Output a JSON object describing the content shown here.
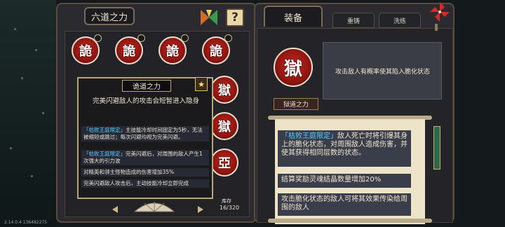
{
  "left_panel": {
    "title": "六道之力",
    "orbs": [
      "詭",
      "詭",
      "詭",
      "詭"
    ],
    "storage_label": "库存",
    "storage_count": "16/320",
    "partial_orb_glyphs": [
      "獄",
      "獄",
      "亞"
    ]
  },
  "tooltip": {
    "title": "诡道之力",
    "description": "完美闪避敌人的攻击会短暂进入隐身",
    "rows": [
      {
        "highlight": "「枯败王庭限定」",
        "text": "主技能冷却时间固定为5秒，无法被缩短或跳过；每次闪避均视为完美闪避。"
      },
      {
        "highlight": "「枯败王庭限定」",
        "text": "完美闪避后，对周围的敌人产生1次强大的引力波"
      },
      {
        "highlight": "",
        "text": "对精英和领主怪物造成的伤害增加35%"
      },
      {
        "highlight": "",
        "text": "完美闪避敌人攻击后，主动技能冷却立即完成"
      }
    ]
  },
  "right_panel": {
    "tabs": [
      "装备",
      "重铸",
      "洗练"
    ],
    "main_orb_glyph": "獄",
    "effect_text": "攻击敌人有概率使其陷入脆化状态",
    "name_plate": "狱道之力",
    "items": [
      {
        "highlight": "「枯败王庭限定」",
        "text": "敌人死亡时将引爆其身上的脆化状态，对周围敌人造成伤害，并使其获得相同层数的状态。"
      },
      {
        "highlight": "",
        "text": "结算奖励灵魂结晶数量增加20%"
      },
      {
        "highlight": "",
        "text": "攻击脆化状态的敌人可将其效果传染给周围的敌人"
      }
    ]
  },
  "version": "2.14.0.4 136482275",
  "colors": {
    "orb_red": "#c8281e",
    "highlight": "#4fd0ff",
    "scroll": "#ece3c8"
  }
}
